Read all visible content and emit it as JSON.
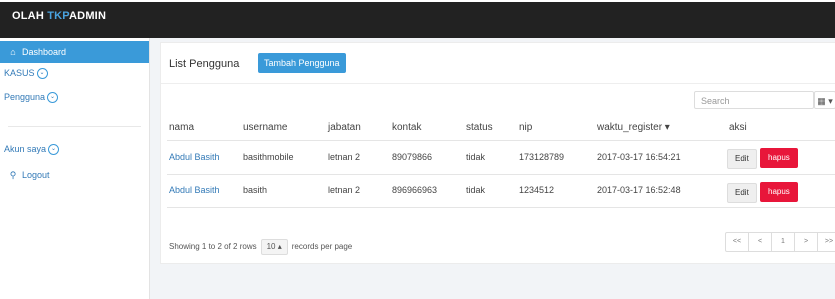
{
  "app": {
    "brand_part1": "OLAH ",
    "brand_part2": "TKP",
    "brand_part3": "ADMIN"
  },
  "sidebar": {
    "dashboard": "Dashboard",
    "kasus": "KASUS",
    "pengguna": "Pengguna",
    "akun": "Akun saya",
    "logout": "Logout"
  },
  "panel": {
    "title": "List Pengguna",
    "add_button": "Tambah Pengguna",
    "search_placeholder": "Search"
  },
  "table": {
    "headers": [
      "nama",
      "username",
      "jabatan",
      "kontak",
      "status",
      "nip",
      "waktu_register ▾",
      "aksi"
    ],
    "rows": [
      {
        "nama": "Abdul Basith",
        "username": "basithmobile",
        "jabatan": "letnan 2",
        "kontak": "89079866",
        "status": "tidak",
        "nip": "173128789",
        "waktu_register": "2017-03-17 16:54:21",
        "edit": "Edit",
        "hapus": "hapus"
      },
      {
        "nama": "Abdul Basith",
        "username": "basith",
        "jabatan": "letnan 2",
        "kontak": "896966963",
        "status": "tidak",
        "nip": "1234512",
        "waktu_register": "2017-03-17 16:52:48",
        "edit": "Edit",
        "hapus": "hapus"
      }
    ]
  },
  "footer": {
    "showing": "Showing 1 to 2 of 2 rows",
    "page_size": "10",
    "records": "records per page",
    "pager": [
      "<<",
      "<",
      "1",
      ">",
      ">>"
    ]
  },
  "colors": {
    "accent": "#3a9ad9",
    "danger": "#e8163a",
    "navbar": "#222222"
  }
}
